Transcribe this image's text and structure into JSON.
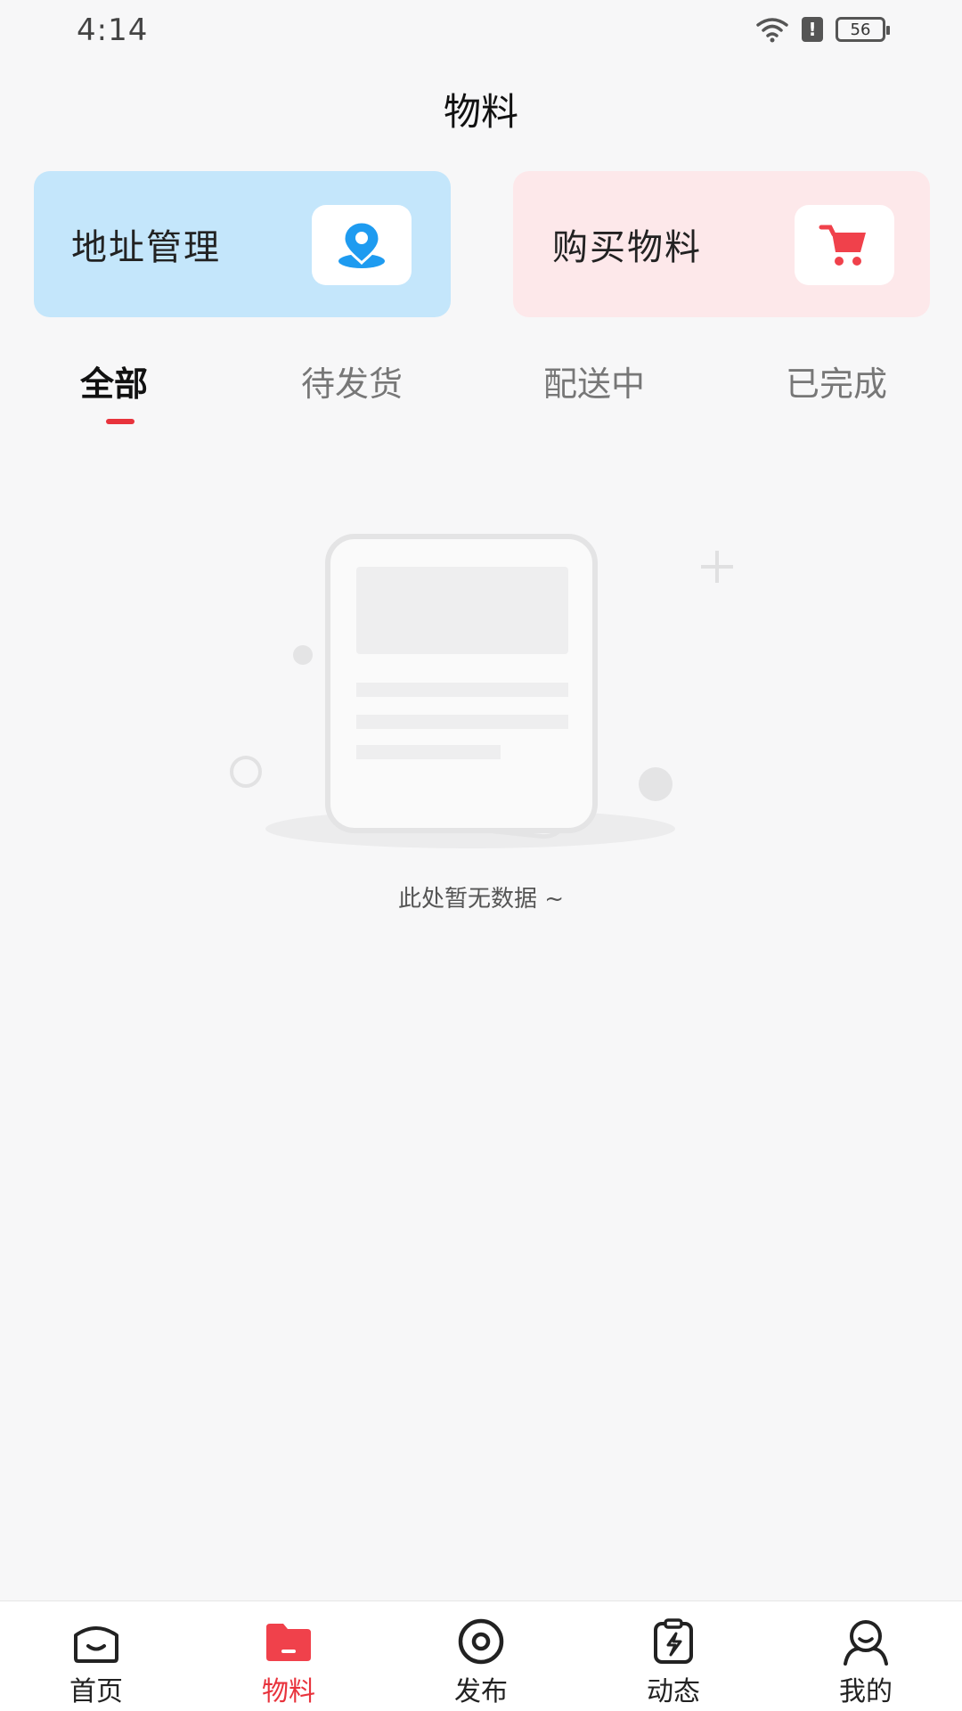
{
  "status_bar": {
    "time": "4:14",
    "battery": "56"
  },
  "header": {
    "title": "物料"
  },
  "cards": {
    "address": {
      "label": "地址管理",
      "icon": "location-pin-icon"
    },
    "buy": {
      "label": "购买物料",
      "icon": "shopping-cart-icon"
    }
  },
  "tabs": [
    {
      "label": "全部",
      "active": true
    },
    {
      "label": "待发货",
      "active": false
    },
    {
      "label": "配送中",
      "active": false
    },
    {
      "label": "已完成",
      "active": false
    }
  ],
  "empty_state": {
    "text": "此处暂无数据 ~",
    "icon": "empty-document-icon"
  },
  "bottom_nav": [
    {
      "label": "首页",
      "icon": "home-icon",
      "active": false
    },
    {
      "label": "物料",
      "icon": "folder-icon",
      "active": true
    },
    {
      "label": "发布",
      "icon": "eye-icon",
      "active": false
    },
    {
      "label": "动态",
      "icon": "clipboard-lightning-icon",
      "active": false
    },
    {
      "label": "我的",
      "icon": "user-icon",
      "active": false
    }
  ],
  "colors": {
    "accent": "#e8333c",
    "address_card_bg": "#c4e6fb",
    "buy_card_bg": "#fde8ea",
    "location_icon": "#1e9bf0",
    "cart_icon": "#f0414b"
  }
}
